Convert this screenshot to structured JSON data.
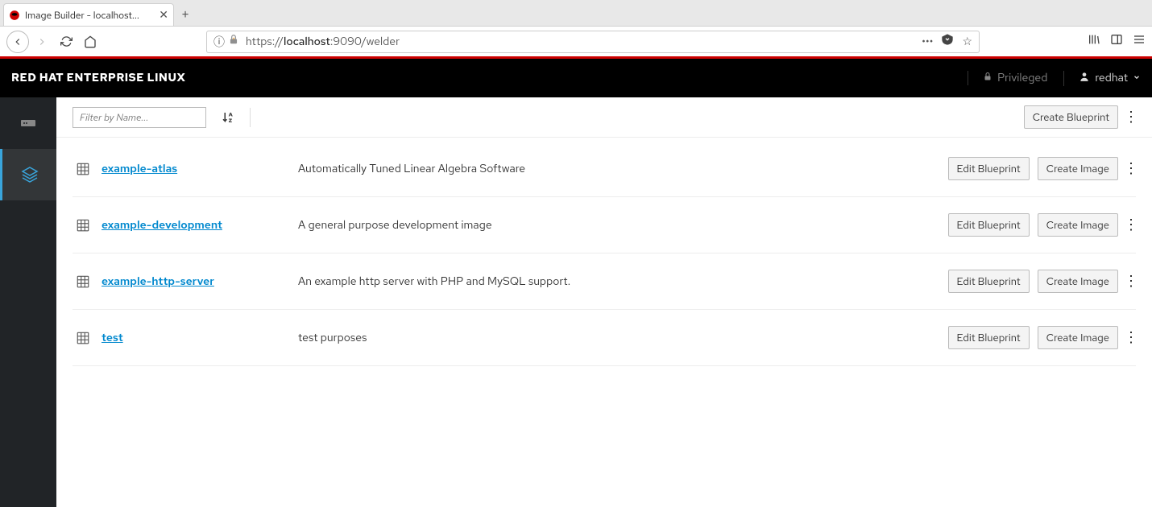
{
  "browser": {
    "tab_title": "Image Builder - localhost...",
    "url_prefix": "https://",
    "url_host": "localhost",
    "url_port": ":9090",
    "url_path": "/welder"
  },
  "header": {
    "brand": "RED HAT ENTERPRISE LINUX",
    "privileged": "Privileged",
    "username": "redhat"
  },
  "toolbar": {
    "filter_placeholder": "Filter by Name...",
    "create_blueprint": "Create Blueprint"
  },
  "row_actions": {
    "edit": "Edit Blueprint",
    "create_image": "Create Image"
  },
  "blueprints": [
    {
      "name": "example-atlas",
      "desc": "Automatically Tuned Linear Algebra Software"
    },
    {
      "name": "example-development",
      "desc": "A general purpose development image"
    },
    {
      "name": "example-http-server",
      "desc": "An example http server with PHP and MySQL support."
    },
    {
      "name": "test",
      "desc": "test purposes"
    }
  ]
}
